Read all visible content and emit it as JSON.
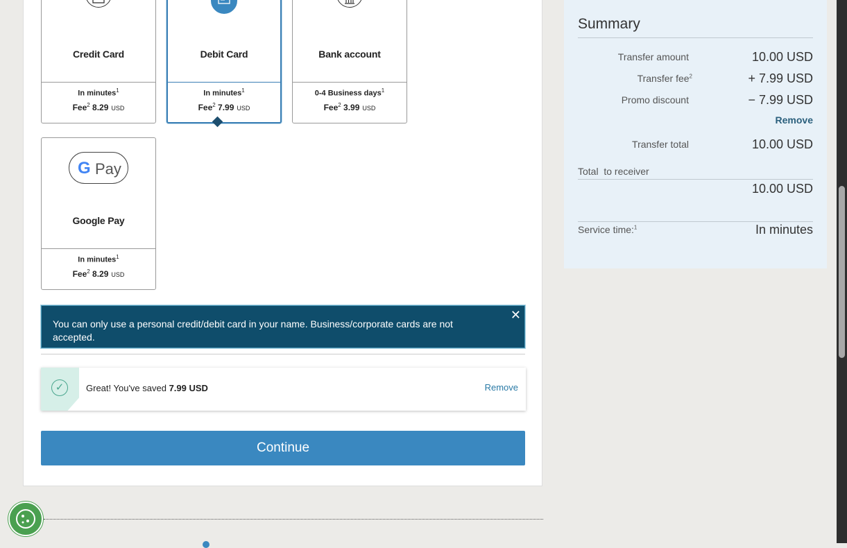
{
  "cards": [
    {
      "name": "Credit Card",
      "speed": "In minutes",
      "speed_sup": "1",
      "fee_label": "Fee",
      "fee_sup": "2",
      "fee": "8.29",
      "currency": "USD",
      "icon": "credit-card-icon"
    },
    {
      "name": "Debit Card",
      "speed": "In minutes",
      "speed_sup": "1",
      "fee_label": "Fee",
      "fee_sup": "2",
      "fee": "7.99",
      "currency": "USD",
      "icon": "debit-card-icon",
      "selected": true
    },
    {
      "name": "Bank account",
      "speed": "0-4 Business days",
      "speed_sup": "1",
      "fee_label": "Fee",
      "fee_sup": "2",
      "fee": "3.99",
      "currency": "USD",
      "icon": "bank-icon"
    },
    {
      "name": "Google Pay",
      "speed": "In minutes",
      "speed_sup": "1",
      "fee_label": "Fee",
      "fee_sup": "2",
      "fee": "8.29",
      "currency": "USD",
      "icon": "google-pay-logo",
      "logo_g": "G",
      "logo_pay": "Pay"
    }
  ],
  "notice": {
    "text": "You can only use a personal credit/debit card in your name. Business/corporate cards are not accepted.",
    "close": "✕"
  },
  "promo": {
    "saved_prefix": "Great! You've saved",
    "saved_amount": "7.99 USD",
    "remove": "Remove",
    "check": "✓"
  },
  "continue_label": "Continue",
  "summary": {
    "title": "Summary",
    "transfer_amount_label": "Transfer amount",
    "transfer_amount": "10.00 USD",
    "transfer_fee_label": "Transfer fee",
    "transfer_fee_sup": "2",
    "transfer_fee": "+ 7.99 USD",
    "promo_label": "Promo discount",
    "promo_value": "− 7.99 USD",
    "remove": "Remove",
    "transfer_total_label": "Transfer total",
    "transfer_total": "10.00 USD",
    "receiver_label": "Total  to receiver",
    "receiver_value": "10.00 USD",
    "service_label": "Service time:",
    "service_sup": "1",
    "service_value": "In minutes"
  },
  "colors": {
    "accent": "#3a88c0",
    "notice_bg": "#0f4d6b",
    "summary_bg": "#e8f1f8",
    "success": "#4aa68e"
  }
}
